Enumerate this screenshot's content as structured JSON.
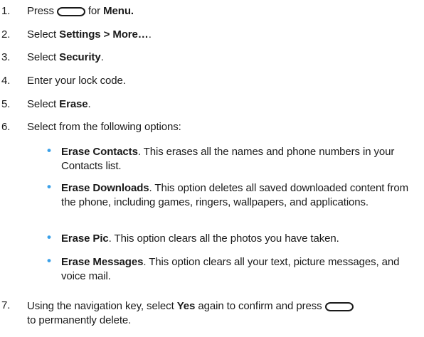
{
  "steps": [
    {
      "num": "1.",
      "pre": "Press",
      "post": "for",
      "bold": "Menu."
    },
    {
      "num": "2.",
      "pre": "Select",
      "bold": "Settings > More…",
      "post": "."
    },
    {
      "num": "3.",
      "pre": "Select",
      "bold": "Security",
      "post": "."
    },
    {
      "num": "4.",
      "text": "Enter your lock code."
    },
    {
      "num": "5.",
      "pre": "Select",
      "bold": "Erase",
      "post": "."
    },
    {
      "num": "6.",
      "text": "Select from the following options:"
    },
    {
      "num": "7.",
      "pre": "Using the navigation key, select",
      "bold": "Yes",
      "mid": "again to confirm and press",
      "post": "to permanently delete."
    }
  ],
  "bullets": [
    {
      "bold": "Erase Contacts",
      "text": ". This erases all the names and phone numbers in your Contacts list."
    },
    {
      "bold": "Erase Downloads",
      "text": ". This option deletes all saved downloaded content from the phone, including games, ringers, wallpapers, and applications."
    },
    {
      "bold": "Erase Pic",
      "text": ". This option clears all the photos you have taken."
    },
    {
      "bold": "Erase Messages",
      "text": ". This option clears all your text, picture messages, and voice mail."
    }
  ],
  "icons": {
    "key_icon": "menu-key-icon",
    "bullet_color": "#3aa0e8"
  }
}
